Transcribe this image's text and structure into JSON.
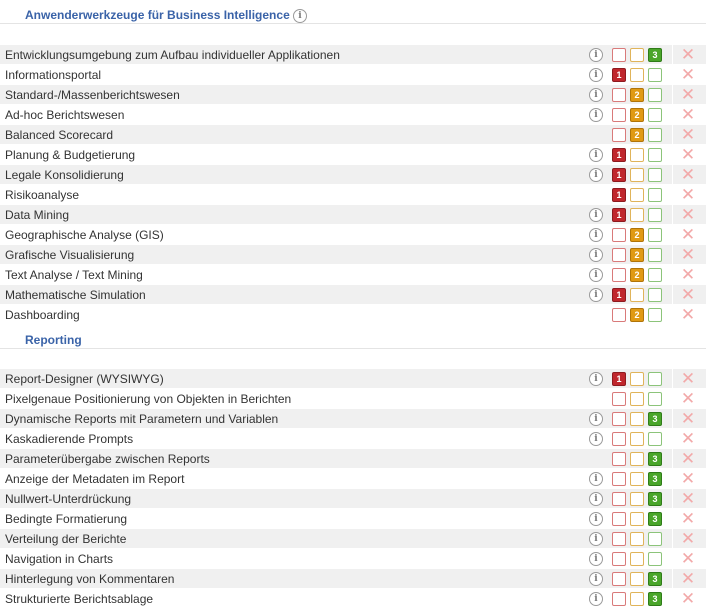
{
  "info_glyph": "i",
  "delete_glyph": "✕",
  "colors": {
    "accent": "#3a63a8",
    "level1": "#c0272d",
    "level2": "#e09a14",
    "level3": "#4aa52a",
    "delete": "#f2a9a9"
  },
  "sections": [
    {
      "title": "Anwenderwerkzeuge für Business Intelligence",
      "has_info": true,
      "rows": [
        {
          "label": "Entwicklungsumgebung zum Aufbau individueller Applikationen",
          "info": true,
          "level": 3
        },
        {
          "label": "Informationsportal",
          "info": true,
          "level": 1
        },
        {
          "label": "Standard-/Massenberichtswesen",
          "info": true,
          "level": 2
        },
        {
          "label": "Ad-hoc Berichtswesen",
          "info": true,
          "level": 2
        },
        {
          "label": "Balanced Scorecard",
          "info": false,
          "level": 2
        },
        {
          "label": "Planung & Budgetierung",
          "info": true,
          "level": 1
        },
        {
          "label": "Legale Konsolidierung",
          "info": true,
          "level": 1
        },
        {
          "label": "Risikoanalyse",
          "info": false,
          "level": 1
        },
        {
          "label": "Data Mining",
          "info": true,
          "level": 1
        },
        {
          "label": "Geographische Analyse (GIS)",
          "info": true,
          "level": 2
        },
        {
          "label": "Grafische Visualisierung",
          "info": true,
          "level": 2
        },
        {
          "label": "Text Analyse / Text Mining",
          "info": true,
          "level": 2
        },
        {
          "label": "Mathematische Simulation",
          "info": true,
          "level": 1
        },
        {
          "label": "Dashboarding",
          "info": false,
          "level": 2
        }
      ]
    },
    {
      "title": "Reporting",
      "has_info": false,
      "rows": [
        {
          "label": "Report-Designer (WYSIWYG)",
          "info": true,
          "level": 1
        },
        {
          "label": "Pixelgenaue Positionierung von Objekten in Berichten",
          "info": false,
          "level": 0
        },
        {
          "label": "Dynamische Reports mit Parametern und Variablen",
          "info": true,
          "level": 3
        },
        {
          "label": "Kaskadierende Prompts",
          "info": true,
          "level": 0
        },
        {
          "label": "Parameterübergabe zwischen Reports",
          "info": false,
          "level": 3
        },
        {
          "label": "Anzeige der Metadaten im Report",
          "info": true,
          "level": 3
        },
        {
          "label": "Nullwert-Unterdrückung",
          "info": true,
          "level": 3
        },
        {
          "label": "Bedingte Formatierung",
          "info": true,
          "level": 3
        },
        {
          "label": "Verteilung der Berichte",
          "info": true,
          "level": 0
        },
        {
          "label": "Navigation in Charts",
          "info": true,
          "level": 0
        },
        {
          "label": "Hinterlegung von Kommentaren",
          "info": true,
          "level": 3
        },
        {
          "label": "Strukturierte Berichtsablage",
          "info": true,
          "level": 3
        }
      ]
    }
  ]
}
